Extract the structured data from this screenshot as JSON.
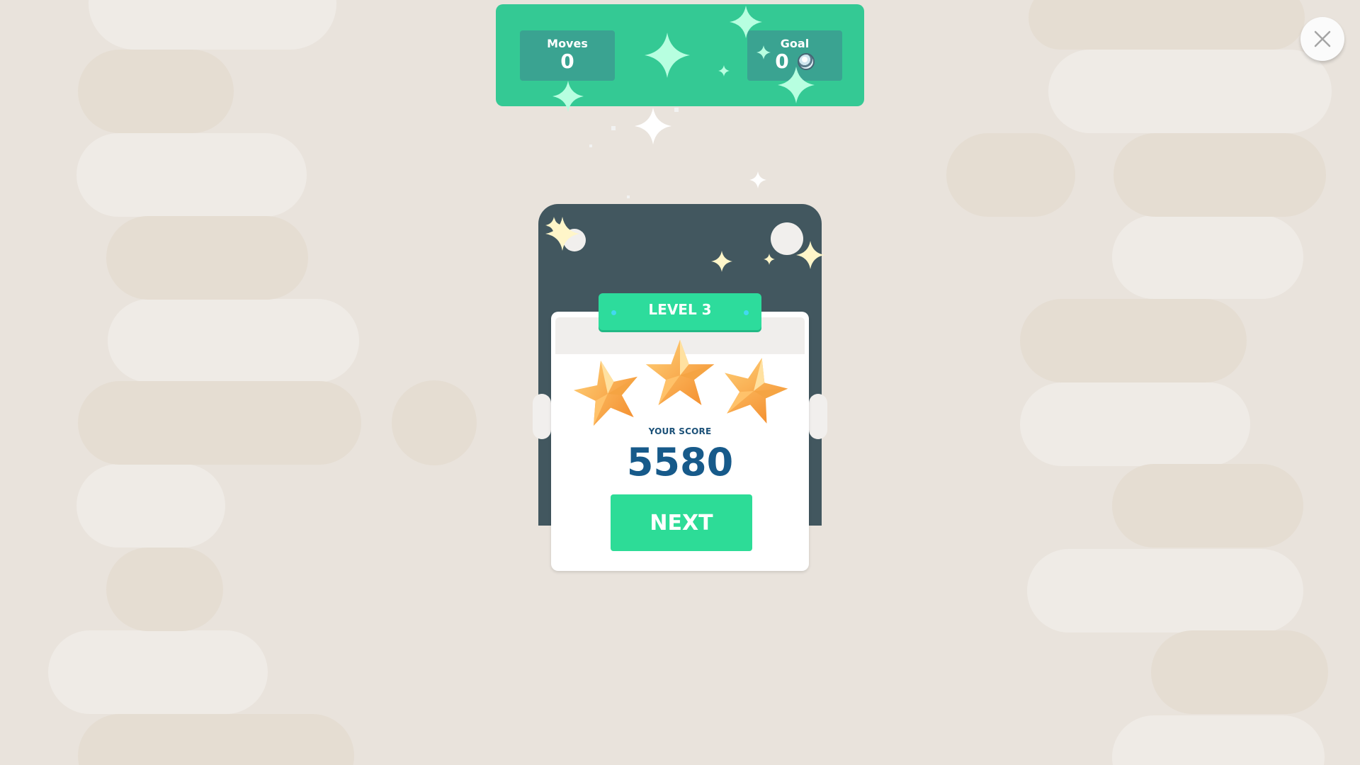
{
  "hud": {
    "moves_label": "Moves",
    "moves_value": "0",
    "goal_label": "Goal",
    "goal_value": "0",
    "goal_icon": "gem-icon"
  },
  "close_icon": "close-icon",
  "level_card": {
    "banner": "LEVEL 3",
    "stars_earned": 3,
    "stars_total": 3,
    "score_label": "YOUR SCORE",
    "score_value": "5580",
    "next_label": "NEXT"
  },
  "colors": {
    "background": "#e9e3dc",
    "hud_green": "#34c994",
    "hud_box": "#3aa391",
    "board": "#42575f",
    "accent_green": "#2ddc97",
    "score_blue": "#175a8a",
    "star_orange": "#f8a23a"
  }
}
